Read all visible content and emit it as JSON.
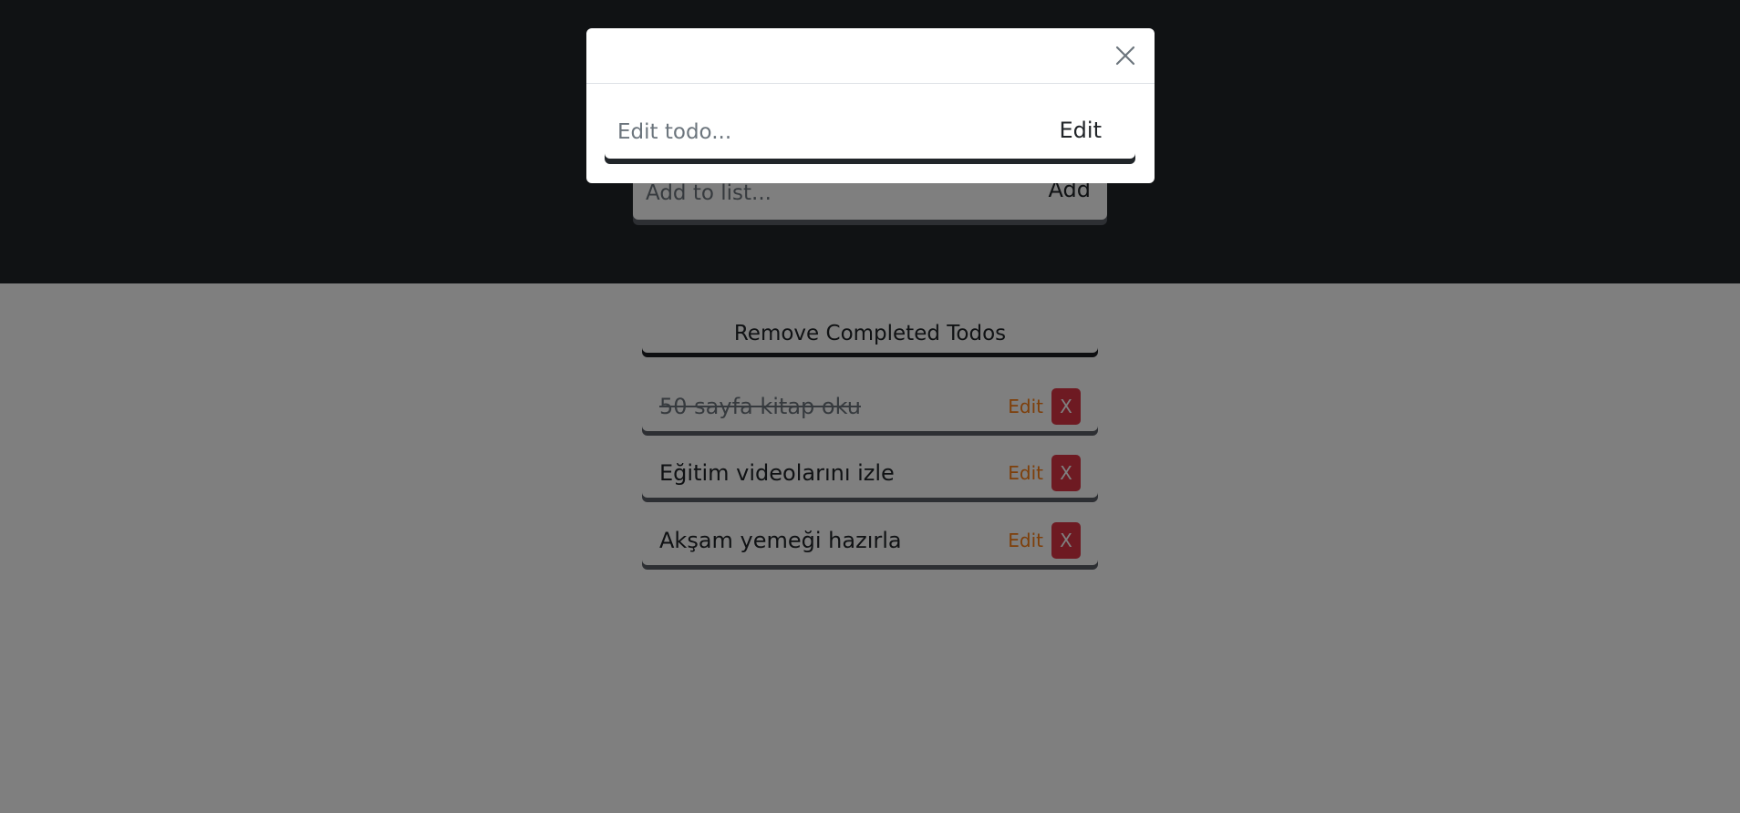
{
  "add_form": {
    "placeholder": "Add to list...",
    "button_label": "Add"
  },
  "remove_completed_label": "Remove Completed Todos",
  "todos": [
    {
      "text": "50 sayfa kitap oku",
      "completed": true,
      "edit_label": "Edit",
      "delete_label": "X"
    },
    {
      "text": "Eğitim videolarını izle",
      "completed": false,
      "edit_label": "Edit",
      "delete_label": "X"
    },
    {
      "text": "Akşam yemeği hazırla",
      "completed": false,
      "edit_label": "Edit",
      "delete_label": "X"
    }
  ],
  "modal": {
    "close_icon": "close-icon",
    "edit_placeholder": "Edit todo...",
    "edit_button_label": "Edit"
  },
  "colors": {
    "header_bg": "#212529",
    "accent_edit": "#fd7e14",
    "danger": "#dc3545",
    "overlay": "rgba(0,0,0,0.5)"
  }
}
